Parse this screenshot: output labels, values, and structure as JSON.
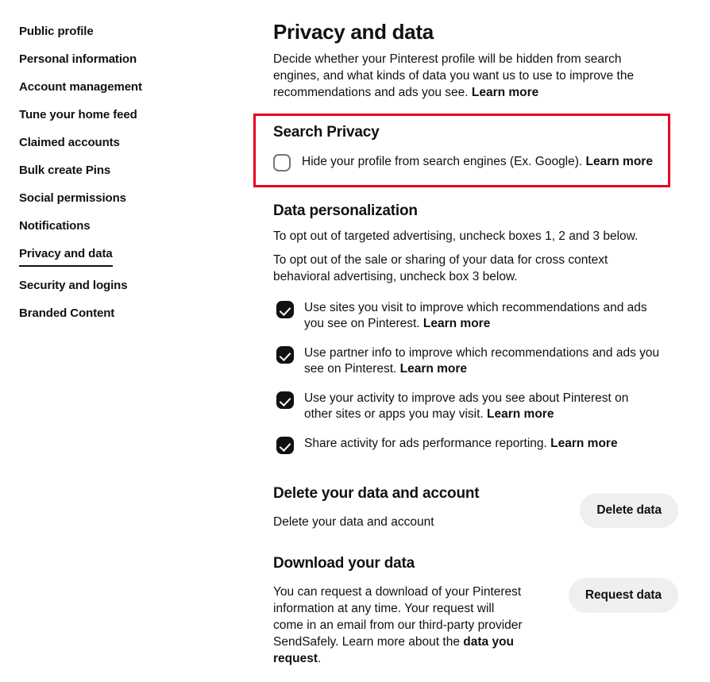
{
  "sidebar": {
    "items": [
      {
        "label": "Public profile",
        "active": false
      },
      {
        "label": "Personal information",
        "active": false
      },
      {
        "label": "Account management",
        "active": false
      },
      {
        "label": "Tune your home feed",
        "active": false
      },
      {
        "label": "Claimed accounts",
        "active": false
      },
      {
        "label": "Bulk create Pins",
        "active": false
      },
      {
        "label": "Social permissions",
        "active": false
      },
      {
        "label": "Notifications",
        "active": false
      },
      {
        "label": "Privacy and data",
        "active": true
      },
      {
        "label": "Security and logins",
        "active": false
      },
      {
        "label": "Branded Content",
        "active": false
      }
    ]
  },
  "main": {
    "title": "Privacy and data",
    "intro_text": "Decide whether your Pinterest profile will be hidden from search engines, and what kinds of data you want us to use to improve the recommendations and ads you see. ",
    "intro_link": "Learn more"
  },
  "search_privacy": {
    "title": "Search Privacy",
    "checkbox_label": "Hide your profile from search engines (Ex. Google). ",
    "checkbox_link": "Learn more",
    "checked": false,
    "highlight_color": "#e60023"
  },
  "data_personalization": {
    "title": "Data personalization",
    "paragraph_1": "To opt out of targeted advertising, uncheck boxes 1, 2 and 3 below.",
    "paragraph_2": "To opt out of the sale or sharing of your data for cross context behavioral advertising, uncheck box 3 below.",
    "options": [
      {
        "label": "Use sites you visit to improve which recommendations and ads you see on Pinterest. ",
        "link": "Learn more",
        "checked": true
      },
      {
        "label": "Use partner info to improve which recommendations and ads you see on Pinterest. ",
        "link": "Learn more",
        "checked": true
      },
      {
        "label": "Use your activity to improve ads you see about Pinterest on other sites or apps you may visit. ",
        "link": "Learn more",
        "checked": true
      },
      {
        "label": "Share activity for ads performance reporting. ",
        "link": "Learn more",
        "checked": true
      }
    ]
  },
  "delete_data": {
    "title": "Delete your data and account",
    "description": "Delete your data and account",
    "button_label": "Delete data"
  },
  "download_data": {
    "title": "Download your data",
    "description_part_1": "You can request a download of your Pinterest information at any time. Your request will come in an email from our third-party provider SendSafely. Learn more about the ",
    "description_link": "data you request",
    "description_part_2": ".",
    "button_label": "Request data"
  }
}
